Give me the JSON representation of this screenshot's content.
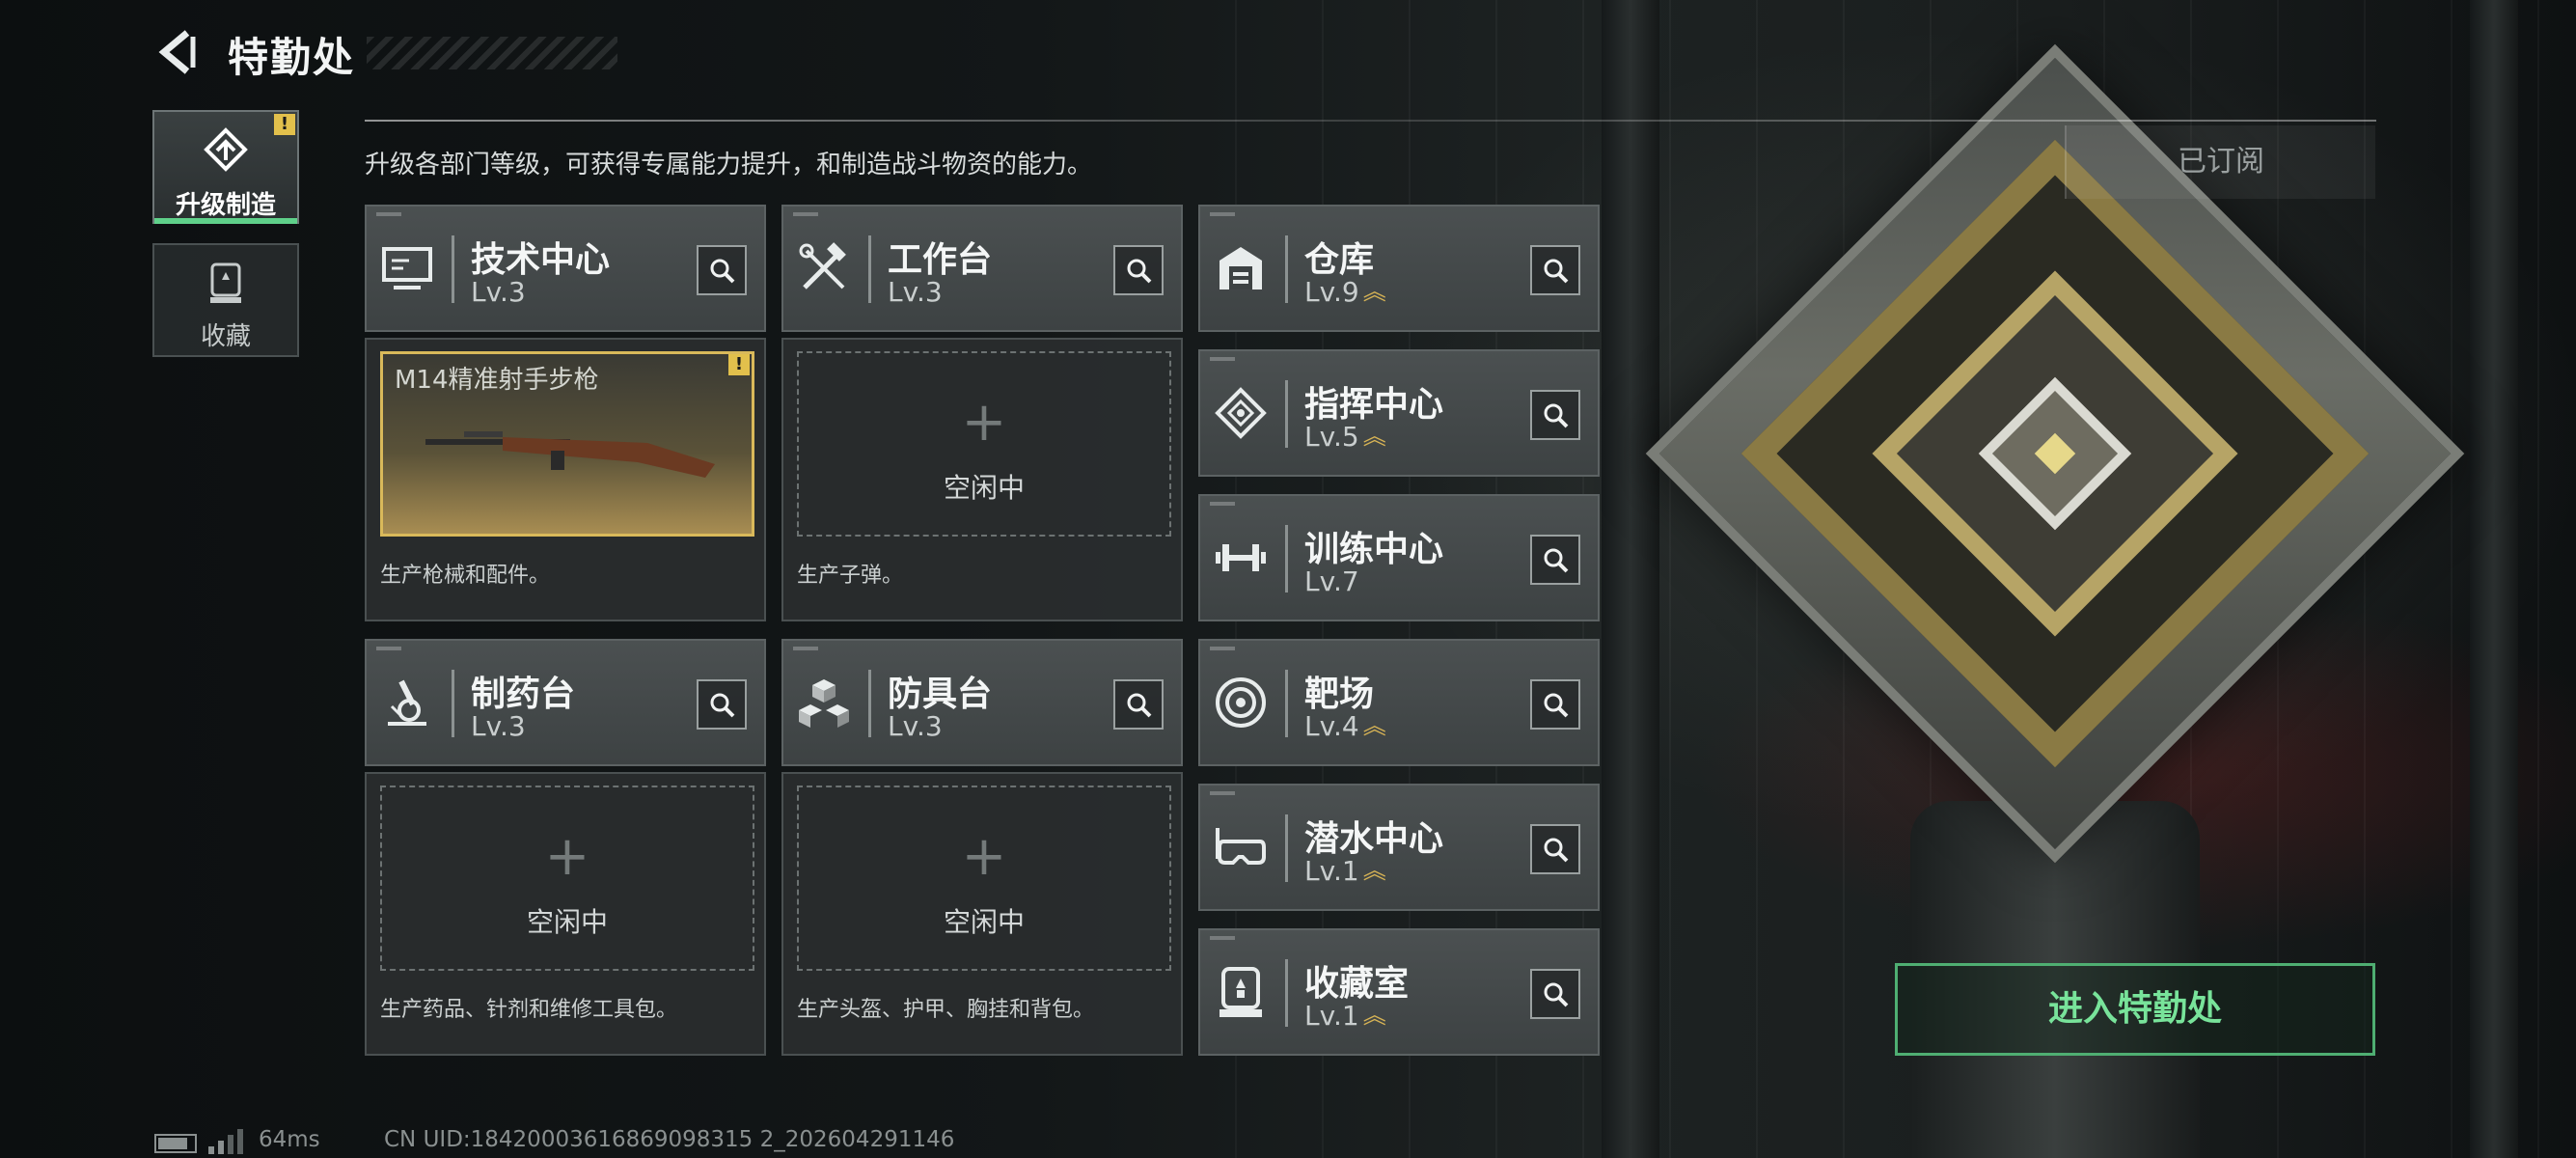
{
  "header": {
    "title": "特勤处",
    "description": "升级各部门等级，可获得专属能力提升，和制造战斗物资的能力。",
    "subscribed_label": "已订阅"
  },
  "side_tabs": [
    {
      "label": "升级制造",
      "active": true,
      "alert": "!"
    },
    {
      "label": "收藏",
      "active": false
    }
  ],
  "departments": [
    {
      "name": "技术中心",
      "level": "Lv.3",
      "icon": "monitor-icon",
      "upgradable": false
    },
    {
      "name": "工作台",
      "level": "Lv.3",
      "icon": "tools-icon",
      "upgradable": false
    },
    {
      "name": "仓库",
      "level": "Lv.9",
      "icon": "warehouse-icon",
      "upgradable": true
    },
    {
      "name": "指挥中心",
      "level": "Lv.5",
      "icon": "command-icon",
      "upgradable": true
    },
    {
      "name": "训练中心",
      "level": "Lv.7",
      "icon": "dumbbell-icon",
      "upgradable": false
    },
    {
      "name": "制药台",
      "level": "Lv.3",
      "icon": "microscope-icon",
      "upgradable": false
    },
    {
      "name": "防具台",
      "level": "Lv.3",
      "icon": "cubes-icon",
      "upgradable": false
    },
    {
      "name": "靶场",
      "level": "Lv.4",
      "icon": "target-icon",
      "upgradable": true
    },
    {
      "name": "潜水中心",
      "level": "Lv.1",
      "icon": "diving-mask-icon",
      "upgradable": true
    },
    {
      "name": "收藏室",
      "level": "Lv.1",
      "icon": "collection-icon",
      "upgradable": true
    }
  ],
  "production": [
    {
      "item": "M14精准射手步枪",
      "status": "",
      "description": "生产枪械和配件。",
      "alert": "!"
    },
    {
      "item": "",
      "status": "空闲中",
      "description": "生产子弹。"
    },
    {
      "item": "",
      "status": "空闲中",
      "description": "生产药品、针剂和维修工具包。"
    },
    {
      "item": "",
      "status": "空闲中",
      "description": "生产头盔、护甲、胸挂和背包。"
    }
  ],
  "plus_symbol": "+",
  "upgrade_arrow": "︽",
  "enter_button": "进入特勤处",
  "status_bar": {
    "latency": "64ms",
    "uid": "CN UID:18420003616869098315 2_202604291146"
  },
  "colors": {
    "accent_green": "#78e39a",
    "alert_yellow": "#e2c04c",
    "level_arrow_gold": "#d8b455"
  }
}
